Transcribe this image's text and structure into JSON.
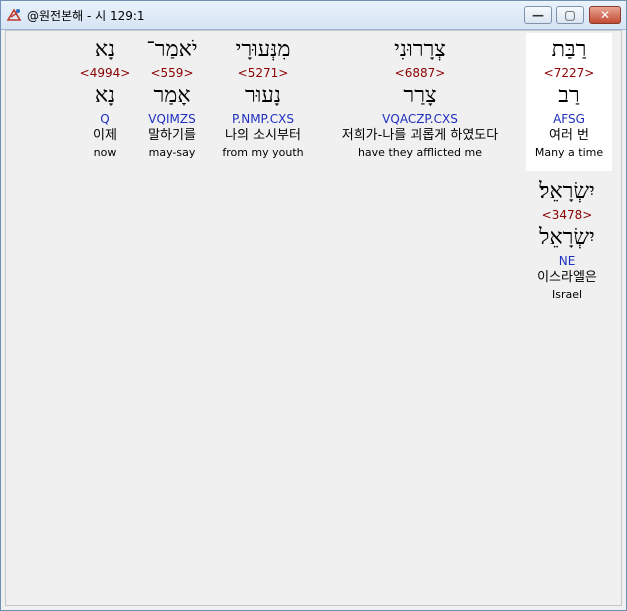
{
  "window": {
    "title": "@원전본해 - 시 129:1",
    "minimize_label": "—",
    "maximize_label": "▢",
    "close_label": "✕"
  },
  "words": [
    {
      "id": "w1",
      "hebrew": "רַבַּת",
      "strong": "<7227>",
      "lemma": "רַב",
      "morph": "AFSG",
      "korean": "여러 번",
      "english": "Many a time"
    },
    {
      "id": "w2",
      "hebrew": "צְרָרוּנִי",
      "strong": "<6887>",
      "lemma": "צָרַר",
      "morph": "VQACZP.CXS",
      "korean": "저희가-나를 괴롭게 하였도다",
      "english": "have they afflicted me"
    },
    {
      "id": "w3",
      "hebrew": "מִנְּעוּרָי",
      "strong": "<5271>",
      "lemma": "נָעוּר",
      "morph": "P.NMP.CXS",
      "korean": "나의 소시부터",
      "english": "from my youth"
    },
    {
      "id": "w4",
      "hebrew": "יֹאמַר־",
      "strong": "<559>",
      "lemma": "אָמַר",
      "morph": "VQIMZS",
      "korean": "말하기를",
      "english": "may-say"
    },
    {
      "id": "w5",
      "hebrew": "נָא",
      "strong": "<4994>",
      "lemma": "נָא",
      "morph": "Q",
      "korean": "이제",
      "english": "now"
    },
    {
      "id": "w6",
      "hebrew": "יִשְׂרָאֵל׃",
      "strong": "<3478>",
      "lemma": "יִשְׂרָאֵל",
      "morph": "NE",
      "korean": "이스라엘은",
      "english": "Israel"
    }
  ]
}
